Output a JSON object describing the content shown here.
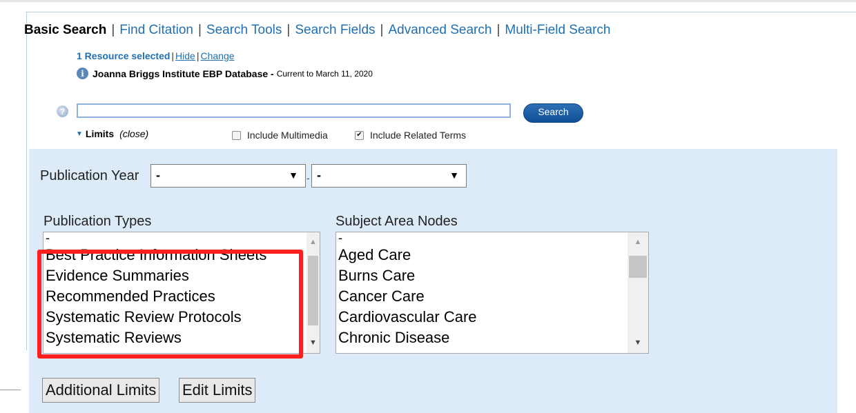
{
  "tabs": [
    {
      "label": "Basic Search",
      "active": true
    },
    {
      "label": "Find Citation"
    },
    {
      "label": "Search Tools"
    },
    {
      "label": "Search Fields"
    },
    {
      "label": "Advanced Search"
    },
    {
      "label": "Multi-Field Search"
    }
  ],
  "resources": {
    "selected": "1 Resource selected",
    "hide": "Hide",
    "change": "Change",
    "database_name": "Joanna Briggs Institute EBP Database -",
    "current_to": "Current to March 11, 2020"
  },
  "search": {
    "value": "",
    "button": "Search"
  },
  "limits": {
    "label": "Limits",
    "close": "(close)",
    "include_multimedia": {
      "label": "Include Multimedia",
      "checked": false
    },
    "include_related_terms": {
      "label": "Include Related Terms",
      "checked": true
    }
  },
  "publication_year": {
    "label": "Publication Year",
    "from": "-",
    "to": "-"
  },
  "publication_types": {
    "label": "Publication Types",
    "items": [
      "-",
      "Best Practice Information Sheets",
      "Evidence Summaries",
      "Recommended Practices",
      "Systematic Review Protocols",
      "Systematic Reviews"
    ]
  },
  "subject_area_nodes": {
    "label": "Subject Area Nodes",
    "items": [
      "-",
      "Aged Care",
      "Burns Care",
      "Cancer Care",
      "Cardiovascular Care",
      "Chronic Disease"
    ]
  },
  "buttons": {
    "additional_limits": "Additional Limits",
    "edit_limits": "Edit Limits"
  },
  "colors": {
    "link": "#1f6fb2",
    "panel": "#ddebf8",
    "highlight": "#ff1f1f",
    "search_button": "#1a5ea8"
  },
  "icons": [
    "info-icon",
    "help-icon",
    "chevron-down-icon",
    "checkbox-icon"
  ]
}
